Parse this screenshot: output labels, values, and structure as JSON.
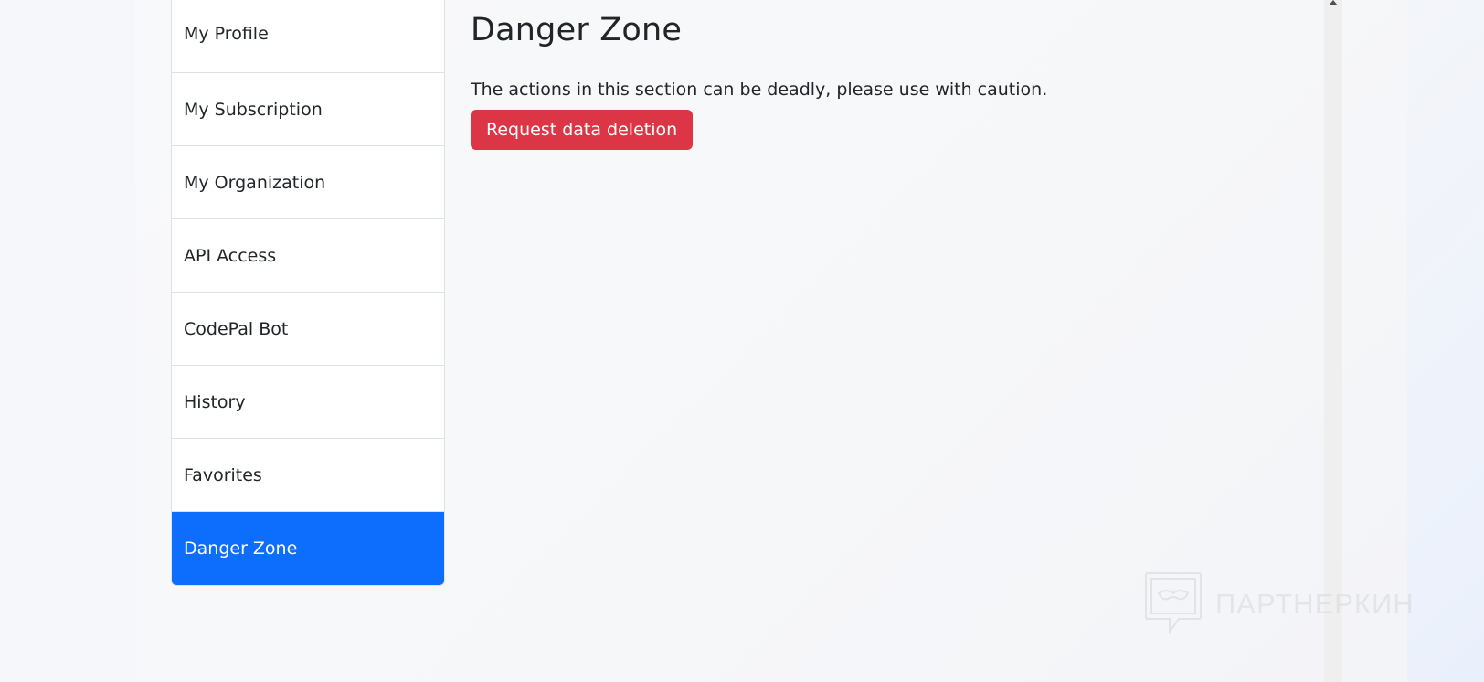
{
  "sidebar": {
    "items": [
      {
        "label": "My Profile"
      },
      {
        "label": "My Subscription"
      },
      {
        "label": "My Organization"
      },
      {
        "label": "API Access"
      },
      {
        "label": "CodePal Bot"
      },
      {
        "label": "History"
      },
      {
        "label": "Favorites"
      },
      {
        "label": "Danger Zone",
        "active": true
      }
    ]
  },
  "main": {
    "title": "Danger Zone",
    "warning": "The actions in this section can be deadly, please use with caution.",
    "delete_button_label": "Request data deletion"
  },
  "watermark": {
    "text": "ПАРТНЕРКИН"
  },
  "colors": {
    "accent": "#0d6efd",
    "danger": "#dc3545"
  }
}
